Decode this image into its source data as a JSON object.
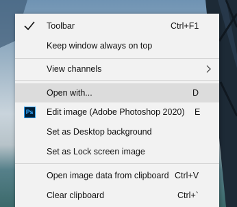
{
  "menu": {
    "items": [
      {
        "label": "Toolbar",
        "shortcut": "Ctrl+F1",
        "checked": true
      },
      {
        "label": "Keep window always on top",
        "shortcut": ""
      },
      {
        "label": "View channels",
        "submenu": true
      },
      {
        "label": "Open with...",
        "shortcut": "D",
        "highlighted": true
      },
      {
        "label": "Edit image (Adobe Photoshop 2020)",
        "shortcut": "E",
        "icon": "photoshop-icon",
        "icon_text": "Ps"
      },
      {
        "label": "Set as Desktop background",
        "shortcut": ""
      },
      {
        "label": "Set as Lock screen image",
        "shortcut": ""
      },
      {
        "label": "Open image data from clipboard",
        "shortcut": "Ctrl+V"
      },
      {
        "label": "Clear clipboard",
        "shortcut": "Ctrl+`"
      }
    ]
  },
  "colors": {
    "menu_background": "#f2f2f2",
    "highlight": "#dcdcdc",
    "photoshop_bg": "#001e36",
    "photoshop_fg": "#31a8ff"
  }
}
